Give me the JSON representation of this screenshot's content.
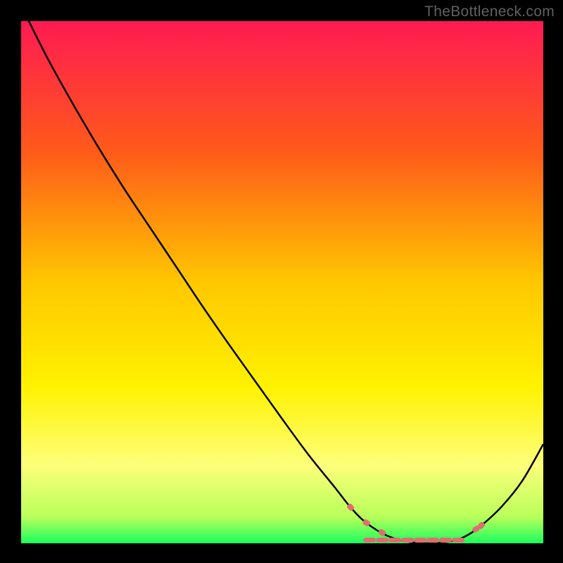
{
  "watermark": "TheBottleneck.com",
  "chart_data": {
    "type": "line",
    "title": "",
    "xlabel": "",
    "ylabel": "",
    "xlim": [
      0,
      100
    ],
    "ylim": [
      0,
      100
    ],
    "gradient_stops": [
      {
        "offset": 0,
        "color": "#ff1a52"
      },
      {
        "offset": 25,
        "color": "#ff5a1a"
      },
      {
        "offset": 50,
        "color": "#ffc700"
      },
      {
        "offset": 70,
        "color": "#fff200"
      },
      {
        "offset": 85,
        "color": "#fdff7a"
      },
      {
        "offset": 95,
        "color": "#b8ff5a"
      },
      {
        "offset": 100,
        "color": "#1aff5e"
      }
    ],
    "series": [
      {
        "name": "bottleneck-curve",
        "x": [
          0,
          5,
          10,
          15,
          20,
          25,
          30,
          35,
          40,
          45,
          50,
          55,
          60,
          63,
          66,
          70,
          74,
          78,
          82,
          85,
          88,
          92,
          96,
          100
        ],
        "y": [
          103,
          93,
          84,
          75.5,
          67.5,
          60,
          52.5,
          45,
          37.8,
          30.8,
          23.8,
          17,
          10.8,
          7,
          4,
          1.5,
          0.3,
          0,
          0.3,
          1.3,
          3.3,
          7,
          12,
          19
        ]
      }
    ],
    "highlight_region": {
      "color": "#de6e6e",
      "xrange": [
        63,
        88
      ],
      "segments_main": {
        "x": [
          66,
          85
        ],
        "y": 0.6
      },
      "ticks": [
        63,
        66,
        69,
        72,
        75,
        78,
        81,
        84,
        87,
        88
      ]
    }
  }
}
